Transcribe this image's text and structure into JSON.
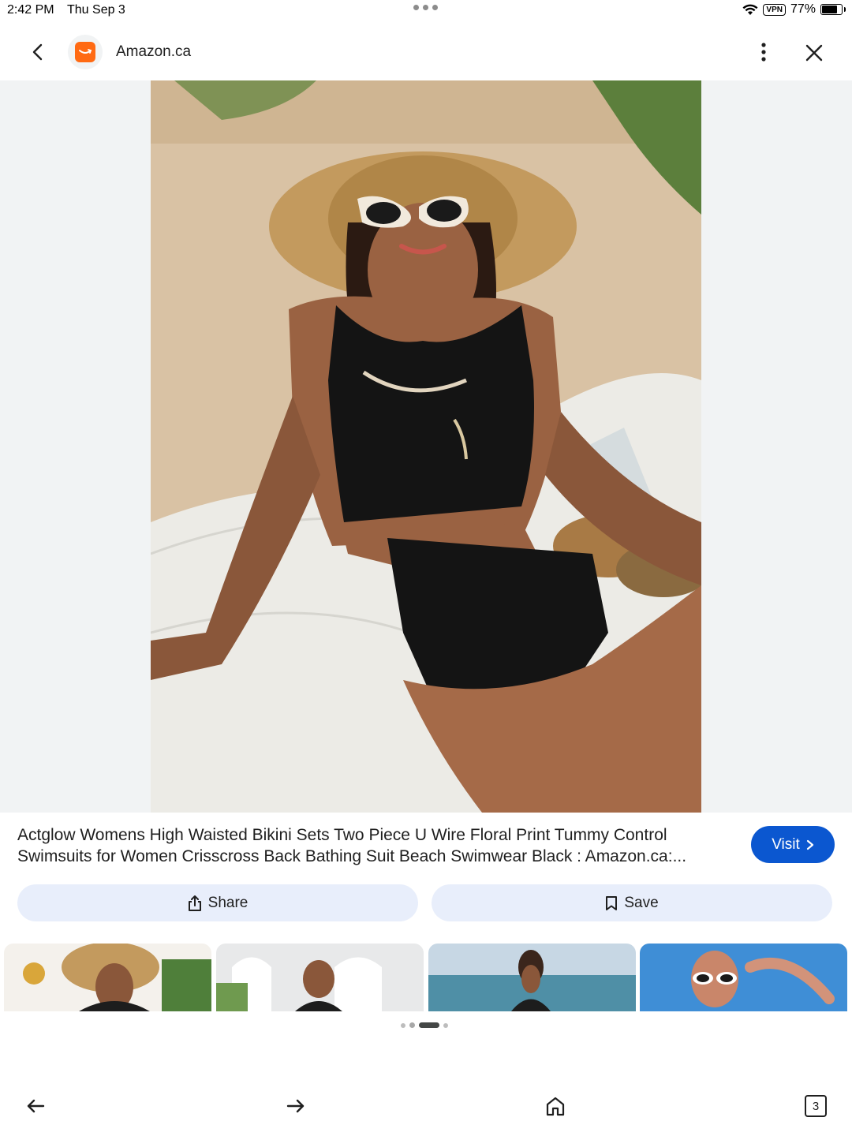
{
  "status": {
    "time": "2:42 PM",
    "date": "Thu Sep 3",
    "vpn": "VPN",
    "battery": "77%",
    "battery_level": 0.77
  },
  "header": {
    "site_name": "Amazon.ca",
    "back_icon": "chevron-left-icon",
    "more_icon": "more-vert-icon",
    "close_icon": "close-icon"
  },
  "result": {
    "title": "Actglow Womens High Waisted Bikini Sets Two Piece U Wire Floral Print Tummy Control Swimsuits for Women Crisscross Back Bathing Suit Beach Swimwear Black : Amazon.ca:...",
    "visit_label": "Visit"
  },
  "actions": {
    "share_label": "Share",
    "save_label": "Save"
  },
  "related": {
    "count": 4
  },
  "pager": {
    "pages": 4,
    "active_index": 2
  },
  "bottom_nav": {
    "tabs_count": "3"
  },
  "colors": {
    "accent": "#0b57d0",
    "action_bg": "#e8eefb",
    "amazon_orange": "#ff6a13"
  }
}
